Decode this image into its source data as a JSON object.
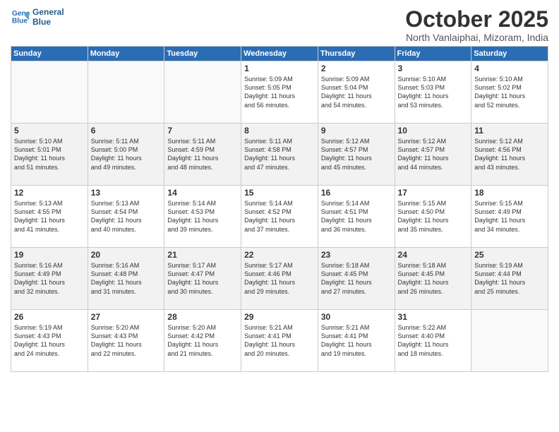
{
  "header": {
    "logo_line1": "General",
    "logo_line2": "Blue",
    "month": "October 2025",
    "location": "North Vanlaiphai, Mizoram, India"
  },
  "weekdays": [
    "Sunday",
    "Monday",
    "Tuesday",
    "Wednesday",
    "Thursday",
    "Friday",
    "Saturday"
  ],
  "weeks": [
    [
      {
        "day": "",
        "text": ""
      },
      {
        "day": "",
        "text": ""
      },
      {
        "day": "",
        "text": ""
      },
      {
        "day": "1",
        "text": "Sunrise: 5:09 AM\nSunset: 5:05 PM\nDaylight: 11 hours\nand 56 minutes."
      },
      {
        "day": "2",
        "text": "Sunrise: 5:09 AM\nSunset: 5:04 PM\nDaylight: 11 hours\nand 54 minutes."
      },
      {
        "day": "3",
        "text": "Sunrise: 5:10 AM\nSunset: 5:03 PM\nDaylight: 11 hours\nand 53 minutes."
      },
      {
        "day": "4",
        "text": "Sunrise: 5:10 AM\nSunset: 5:02 PM\nDaylight: 11 hours\nand 52 minutes."
      }
    ],
    [
      {
        "day": "5",
        "text": "Sunrise: 5:10 AM\nSunset: 5:01 PM\nDaylight: 11 hours\nand 51 minutes."
      },
      {
        "day": "6",
        "text": "Sunrise: 5:11 AM\nSunset: 5:00 PM\nDaylight: 11 hours\nand 49 minutes."
      },
      {
        "day": "7",
        "text": "Sunrise: 5:11 AM\nSunset: 4:59 PM\nDaylight: 11 hours\nand 48 minutes."
      },
      {
        "day": "8",
        "text": "Sunrise: 5:11 AM\nSunset: 4:58 PM\nDaylight: 11 hours\nand 47 minutes."
      },
      {
        "day": "9",
        "text": "Sunrise: 5:12 AM\nSunset: 4:57 PM\nDaylight: 11 hours\nand 45 minutes."
      },
      {
        "day": "10",
        "text": "Sunrise: 5:12 AM\nSunset: 4:57 PM\nDaylight: 11 hours\nand 44 minutes."
      },
      {
        "day": "11",
        "text": "Sunrise: 5:12 AM\nSunset: 4:56 PM\nDaylight: 11 hours\nand 43 minutes."
      }
    ],
    [
      {
        "day": "12",
        "text": "Sunrise: 5:13 AM\nSunset: 4:55 PM\nDaylight: 11 hours\nand 41 minutes."
      },
      {
        "day": "13",
        "text": "Sunrise: 5:13 AM\nSunset: 4:54 PM\nDaylight: 11 hours\nand 40 minutes."
      },
      {
        "day": "14",
        "text": "Sunrise: 5:14 AM\nSunset: 4:53 PM\nDaylight: 11 hours\nand 39 minutes."
      },
      {
        "day": "15",
        "text": "Sunrise: 5:14 AM\nSunset: 4:52 PM\nDaylight: 11 hours\nand 37 minutes."
      },
      {
        "day": "16",
        "text": "Sunrise: 5:14 AM\nSunset: 4:51 PM\nDaylight: 11 hours\nand 36 minutes."
      },
      {
        "day": "17",
        "text": "Sunrise: 5:15 AM\nSunset: 4:50 PM\nDaylight: 11 hours\nand 35 minutes."
      },
      {
        "day": "18",
        "text": "Sunrise: 5:15 AM\nSunset: 4:49 PM\nDaylight: 11 hours\nand 34 minutes."
      }
    ],
    [
      {
        "day": "19",
        "text": "Sunrise: 5:16 AM\nSunset: 4:49 PM\nDaylight: 11 hours\nand 32 minutes."
      },
      {
        "day": "20",
        "text": "Sunrise: 5:16 AM\nSunset: 4:48 PM\nDaylight: 11 hours\nand 31 minutes."
      },
      {
        "day": "21",
        "text": "Sunrise: 5:17 AM\nSunset: 4:47 PM\nDaylight: 11 hours\nand 30 minutes."
      },
      {
        "day": "22",
        "text": "Sunrise: 5:17 AM\nSunset: 4:46 PM\nDaylight: 11 hours\nand 29 minutes."
      },
      {
        "day": "23",
        "text": "Sunrise: 5:18 AM\nSunset: 4:45 PM\nDaylight: 11 hours\nand 27 minutes."
      },
      {
        "day": "24",
        "text": "Sunrise: 5:18 AM\nSunset: 4:45 PM\nDaylight: 11 hours\nand 26 minutes."
      },
      {
        "day": "25",
        "text": "Sunrise: 5:19 AM\nSunset: 4:44 PM\nDaylight: 11 hours\nand 25 minutes."
      }
    ],
    [
      {
        "day": "26",
        "text": "Sunrise: 5:19 AM\nSunset: 4:43 PM\nDaylight: 11 hours\nand 24 minutes."
      },
      {
        "day": "27",
        "text": "Sunrise: 5:20 AM\nSunset: 4:43 PM\nDaylight: 11 hours\nand 22 minutes."
      },
      {
        "day": "28",
        "text": "Sunrise: 5:20 AM\nSunset: 4:42 PM\nDaylight: 11 hours\nand 21 minutes."
      },
      {
        "day": "29",
        "text": "Sunrise: 5:21 AM\nSunset: 4:41 PM\nDaylight: 11 hours\nand 20 minutes."
      },
      {
        "day": "30",
        "text": "Sunrise: 5:21 AM\nSunset: 4:41 PM\nDaylight: 11 hours\nand 19 minutes."
      },
      {
        "day": "31",
        "text": "Sunrise: 5:22 AM\nSunset: 4:40 PM\nDaylight: 11 hours\nand 18 minutes."
      },
      {
        "day": "",
        "text": ""
      }
    ]
  ]
}
